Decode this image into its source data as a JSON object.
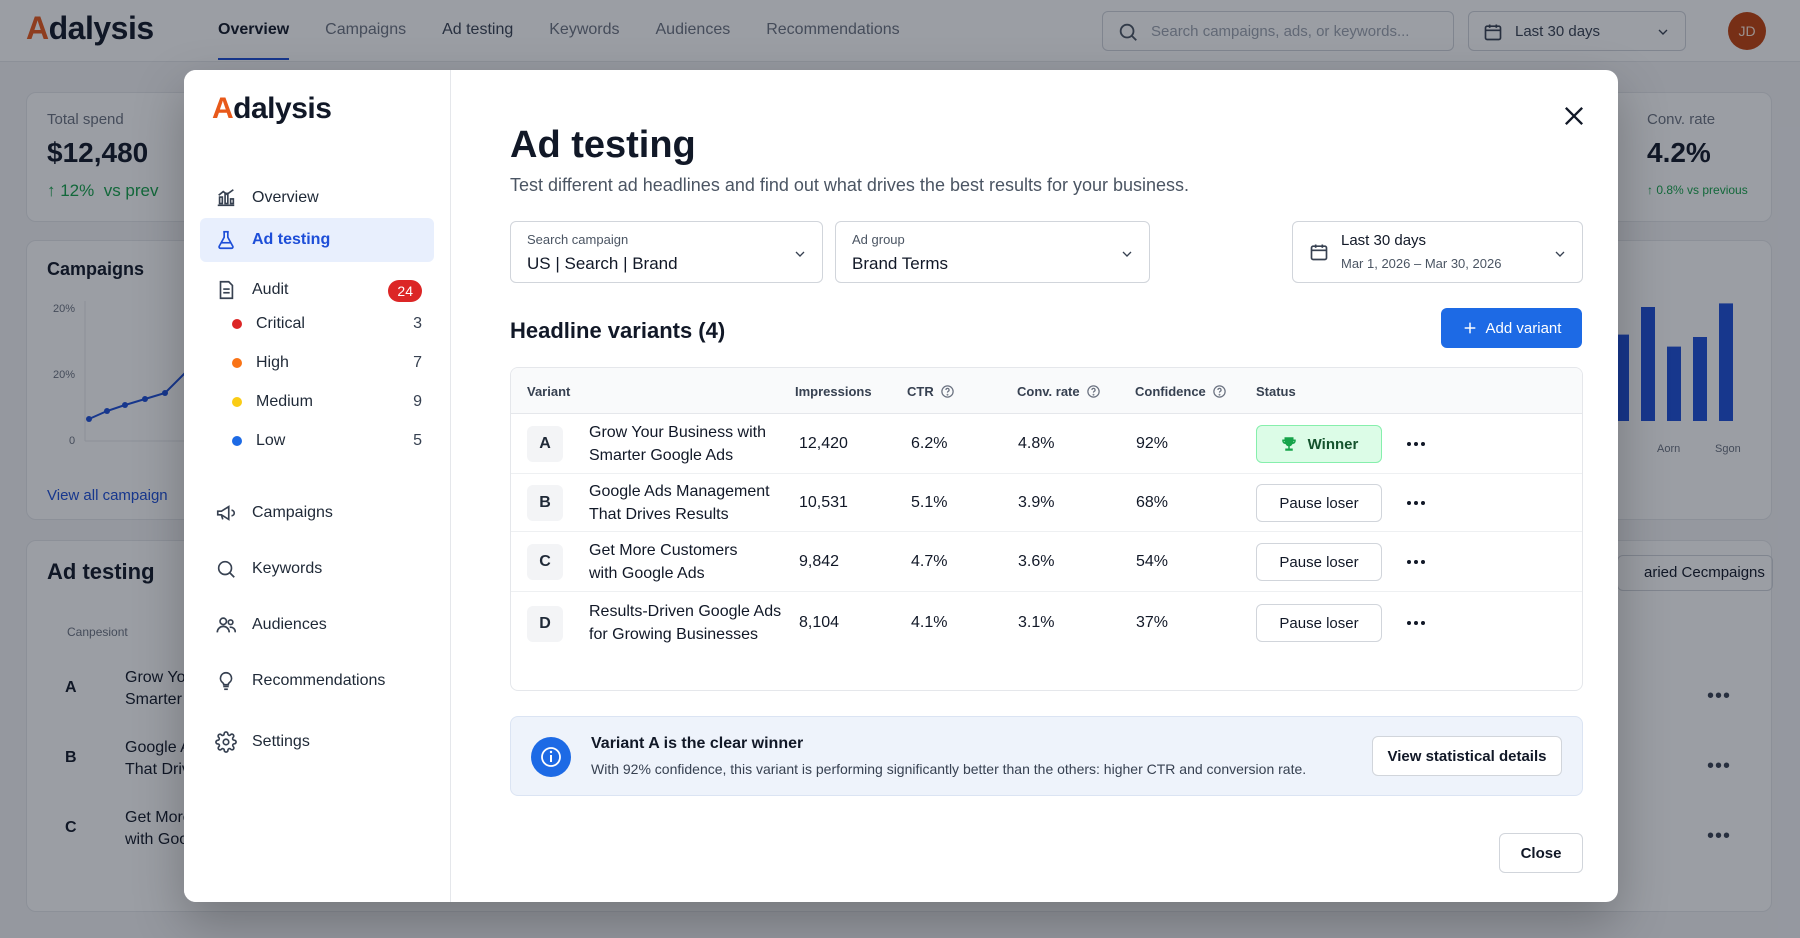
{
  "app": {
    "logo_accent": "A",
    "logo_rest": "dalysis",
    "nav": [
      "Overview",
      "Campaigns",
      "Ad testing",
      "Keywords",
      "Audiences",
      "Recommendations"
    ],
    "search_placeholder": "Search campaigns, ads, or keywords...",
    "date_range": "Last 30 days",
    "avatar_initials": "JD"
  },
  "background": {
    "total_spend_label": "Total spend",
    "total_spend_value": "$12,480",
    "total_spend_delta": "↑ 12%  vs prev",
    "campaigns_title": "Campaigns",
    "axis_labels": [
      "20%",
      "20%",
      "0"
    ],
    "view_all": "View all campaign",
    "ad_testing_title": "Ad testing",
    "table_header": "Canpesiont",
    "rows": [
      {
        "letter": "A",
        "line1": "Grow Yo",
        "line2": "Smarter"
      },
      {
        "letter": "B",
        "line1": "Google A",
        "line2": "That Driv"
      },
      {
        "letter": "C",
        "line1": "Get More",
        "line2": "with Goo"
      }
    ],
    "conv_rate_label": "Conv. rate",
    "conv_rate_value": "4.2%",
    "conv_rate_delta": "↑ 0.8% vs previous",
    "bar_labels": [
      "Aorn",
      "Sgon"
    ],
    "bar_values": [
      0.72,
      0.95,
      0.62,
      0.7,
      0.98
    ],
    "right_button": "aried Cecmpaigns"
  },
  "sidebar": {
    "items": [
      {
        "label": "Overview",
        "icon": "bar-chart-icon"
      },
      {
        "label": "Ad testing",
        "icon": "flask-icon"
      },
      {
        "label": "Audit",
        "icon": "document-icon",
        "badge": "24"
      },
      {
        "label": "Campaigns",
        "icon": "megaphone-icon"
      },
      {
        "label": "Keywords",
        "icon": "search-icon"
      },
      {
        "label": "Audiences",
        "icon": "users-icon"
      },
      {
        "label": "Recommendations",
        "icon": "lightbulb-icon"
      },
      {
        "label": "Settings",
        "icon": "gear-icon"
      }
    ],
    "severity": [
      {
        "label": "Critical",
        "count": "3",
        "color": "#dc2626"
      },
      {
        "label": "High",
        "count": "7",
        "color": "#f97316"
      },
      {
        "label": "Medium",
        "count": "9",
        "color": "#facc15"
      },
      {
        "label": "Low",
        "count": "5",
        "color": "#1d6ae5"
      }
    ]
  },
  "modal": {
    "title": "Ad testing",
    "subtitle": "Test different ad headlines and find out what drives the best results for your business.",
    "filters": {
      "campaign_label": "Search campaign",
      "campaign_value": "US | Search | Brand",
      "adgroup_label": "Ad group",
      "adgroup_value": "Brand Terms",
      "date_label": "Last 30 days",
      "date_value": "Mar 1, 2026 – Mar 30, 2026"
    },
    "section_title": "Headline variants (4)",
    "add_button": "Add variant",
    "columns": [
      "Variant",
      "Impressions",
      "CTR",
      "Conv. rate",
      "Confidence",
      "Status"
    ],
    "variants": [
      {
        "letter": "A",
        "line1": "Grow Your Business with",
        "line2": "Smarter Google Ads",
        "impressions": "12,420",
        "ctr": "6.2%",
        "conv": "4.8%",
        "confidence": "92%",
        "status": "Winner"
      },
      {
        "letter": "B",
        "line1": "Google Ads Management",
        "line2": "That Drives Results",
        "impressions": "10,531",
        "ctr": "5.1%",
        "conv": "3.9%",
        "confidence": "68%",
        "status": "Pause loser"
      },
      {
        "letter": "C",
        "line1": "Get More Customers",
        "line2": "with Google Ads",
        "impressions": "9,842",
        "ctr": "4.7%",
        "conv": "3.6%",
        "confidence": "54%",
        "status": "Pause loser"
      },
      {
        "letter": "D",
        "line1": "Results-Driven Google Ads",
        "line2": "for Growing Businesses",
        "impressions": "8,104",
        "ctr": "4.1%",
        "conv": "3.1%",
        "confidence": "37%",
        "status": "Pause loser"
      }
    ],
    "insight": {
      "title": "Variant A is the clear winner",
      "body": "With 92% confidence, this variant is performing significantly better than the others: higher CTR and conversion rate.",
      "button": "View statistical details"
    },
    "close_button": "Close"
  },
  "colors": {
    "brand_orange": "#e8591a",
    "primary_blue": "#1d6ae5",
    "winner_green": "#16a34a"
  }
}
